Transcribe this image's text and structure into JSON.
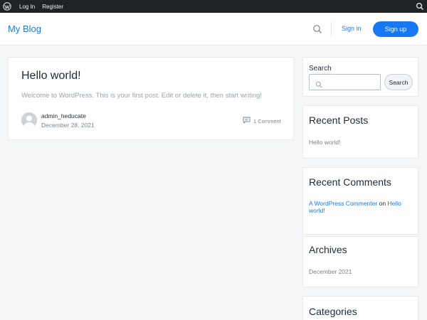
{
  "admin_bar": {
    "logo_icon": "wordpress-icon",
    "login": "Log In",
    "register": "Register",
    "search_icon": "search-icon"
  },
  "header": {
    "site_title": "My Blog",
    "search_icon": "search-icon",
    "signin": "Sign in",
    "signup": "Sign up"
  },
  "post": {
    "title": "Hello world!",
    "excerpt": "Welcome to WordPress. This is your first post. Edit or delete it, then start writing!",
    "author": "admin_heducate",
    "date": "December 28, 2021",
    "comments": "1 Comment",
    "comment_icon": "comment-icon"
  },
  "sidebar": {
    "search": {
      "label": "Search",
      "placeholder": "",
      "button": "Search"
    },
    "recent_posts": {
      "title": "Recent Posts",
      "items": [
        "Hello world!"
      ]
    },
    "recent_comments": {
      "title": "Recent Comments",
      "commenter": "A WordPress Commenter",
      "on": "on",
      "post": "Hello world!"
    },
    "archives": {
      "title": "Archives",
      "items": [
        "December 2021"
      ]
    },
    "categories": {
      "title": "Categories"
    }
  },
  "colors": {
    "accent": "#1877f2",
    "admin_bar": "#1d2327",
    "page_bg": "#f5f6f8"
  }
}
